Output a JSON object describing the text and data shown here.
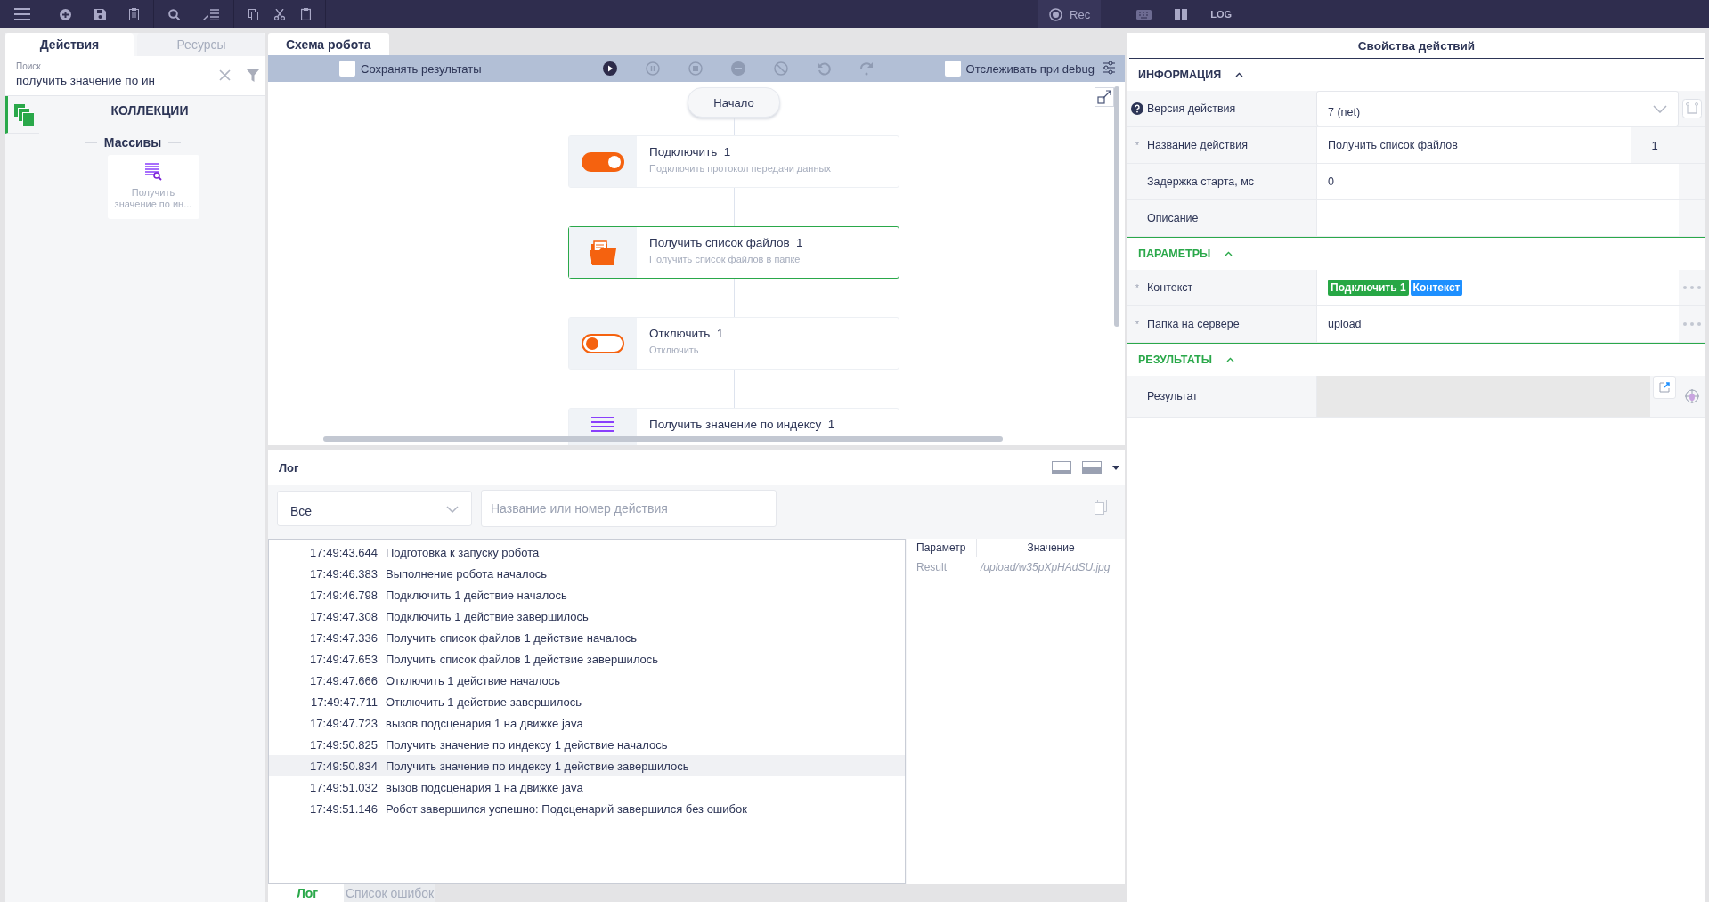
{
  "toolbar": {
    "record_label": "Rec",
    "log_label": "LOG"
  },
  "left_tabs": [
    {
      "label": "Действия",
      "selected": true
    },
    {
      "label": "Ресурсы",
      "selected": false
    }
  ],
  "search": {
    "label": "Поиск",
    "value": "получить значение по ин"
  },
  "category": {
    "title": "КОЛЛЕКЦИИ",
    "group": "Массивы",
    "actions": [
      {
        "label": "Получить значение по ин..."
      }
    ]
  },
  "schema": {
    "tab": "Схема робота",
    "save_results": {
      "label": "Сохранять результаты",
      "checked": false
    },
    "debug": {
      "label": "Отслеживать при debug",
      "checked": false
    },
    "start": "Начало",
    "nodes": [
      {
        "kind": "toggle-on",
        "title": "Подключить  1",
        "subtitle": "Подключить протокол передачи данных",
        "selected": false
      },
      {
        "kind": "folder",
        "title": "Получить список файлов  1",
        "subtitle": "Получить список файлов в папке",
        "selected": true
      },
      {
        "kind": "toggle-off",
        "title": "Отключить  1",
        "subtitle": "Отключить",
        "selected": false
      },
      {
        "kind": "list",
        "title": "Получить значение по индексу  1",
        "selected": false
      }
    ]
  },
  "log": {
    "title": "Лог",
    "filter": "Все",
    "search_placeholder": "Название или номер действия",
    "entries": [
      {
        "time": "17:49:43.644",
        "message": "Подготовка к запуску робота",
        "selected": false
      },
      {
        "time": "17:49:46.383",
        "message": "Выполнение робота началось",
        "selected": false
      },
      {
        "time": "17:49:46.798",
        "message": "Подключить 1 действие началось",
        "selected": false
      },
      {
        "time": "17:49:47.308",
        "message": "Подключить 1 действие завершилось",
        "selected": false
      },
      {
        "time": "17:49:47.336",
        "message": "Получить список файлов 1 действие началось",
        "selected": false
      },
      {
        "time": "17:49:47.653",
        "message": "Получить список файлов 1 действие завершилось",
        "selected": false
      },
      {
        "time": "17:49:47.666",
        "message": "Отключить 1 действие началось",
        "selected": false
      },
      {
        "time": "17:49:47.711",
        "message": "Отключить 1 действие завершилось",
        "selected": false
      },
      {
        "time": "17:49:47.723",
        "message": "вызов подсценария 1 на движке java",
        "selected": false
      },
      {
        "time": "17:49:50.825",
        "message": "Получить значение по индексу 1 действие началось",
        "selected": false
      },
      {
        "time": "17:49:50.834",
        "message": "Получить значение по индексу 1 действие завершилось",
        "selected": true
      },
      {
        "time": "17:49:51.032",
        "message": "вызов подсценария 1 на движке java",
        "selected": false
      },
      {
        "time": "17:49:51.146",
        "message": "Робот завершился успешно: Подсценарий завершился без ошибок",
        "selected": false
      }
    ],
    "params": {
      "columns": [
        "Параметр",
        "Значение"
      ],
      "rows": [
        [
          "Result",
          "/upload/w35pXpHAdSU.jpg"
        ]
      ]
    },
    "tabs": [
      {
        "label": "Лог",
        "selected": true
      },
      {
        "label": "Список ошибок",
        "selected": false
      }
    ]
  },
  "properties": {
    "title": "Свойства действий",
    "sections": [
      {
        "title": "ИНФОРМАЦИЯ",
        "color": "#2d3556",
        "rows": [
          {
            "kind": "select",
            "label": "Версия действия",
            "value": "7 (net)"
          },
          {
            "kind": "text",
            "marker": "*",
            "label": "Название действия",
            "value": "Получить список файлов",
            "suffix": "1"
          },
          {
            "kind": "text",
            "label": "Задержка старта, мс",
            "value": "0"
          },
          {
            "kind": "text",
            "label": "Описание"
          }
        ]
      },
      {
        "title": "ПАРАМЕТРЫ",
        "color": "#2aa84a",
        "rows": [
          {
            "kind": "tokens",
            "marker": "*",
            "label": "Контекст",
            "more": true,
            "tokens": [
              {
                "text": "Подключить 1",
                "color": "#27a745"
              },
              {
                "text": "Контекст",
                "color": "#1e90ff"
              }
            ]
          },
          {
            "kind": "text",
            "marker": "*",
            "label": "Папка на сервере",
            "value": "upload",
            "more": true
          }
        ]
      },
      {
        "title": "РЕЗУЛЬТАТЫ",
        "color": "#2aa84a",
        "rows": [
          {
            "kind": "result",
            "label": "Результат"
          }
        ]
      }
    ]
  }
}
